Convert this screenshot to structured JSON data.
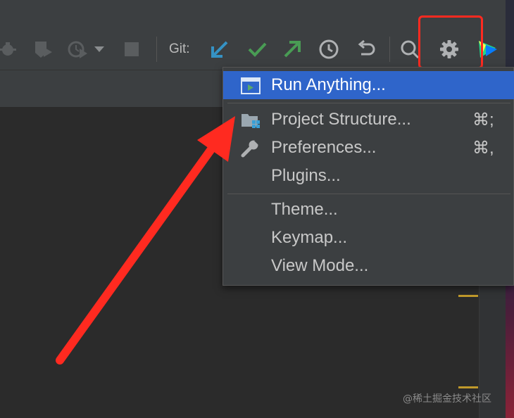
{
  "toolbar": {
    "git_label": "Git:",
    "icons": [
      "debug-icon",
      "coverage-icon",
      "profile-icon",
      "dropdown-arrow-icon",
      "stop-icon",
      "git-update-icon",
      "git-commit-icon",
      "git-push-icon",
      "history-icon",
      "rollback-icon",
      "search-icon",
      "settings-gear-icon",
      "ide-logo-icon"
    ]
  },
  "menu": {
    "items": [
      {
        "label": "Run Anything...",
        "shortcut": "",
        "icon": "run-anything-icon",
        "selected": true
      },
      {
        "label": "Project Structure...",
        "shortcut": "⌘;",
        "icon": "project-structure-icon"
      },
      {
        "label": "Preferences...",
        "shortcut": "⌘,",
        "icon": "wrench-icon"
      },
      {
        "label": "Plugins...",
        "shortcut": ""
      },
      {
        "label": "Theme...",
        "shortcut": ""
      },
      {
        "label": "Keymap...",
        "shortcut": ""
      },
      {
        "label": "View Mode...",
        "shortcut": ""
      }
    ]
  },
  "annotations": {
    "highlight_color": "#ff2a20",
    "arrow_color": "#ff2a20"
  },
  "watermark": "@稀土掘金技术社区",
  "colors": {
    "selection": "#2f65ca",
    "git_update": "#3592c4",
    "git_commit": "#499c54",
    "git_push": "#499c54"
  }
}
